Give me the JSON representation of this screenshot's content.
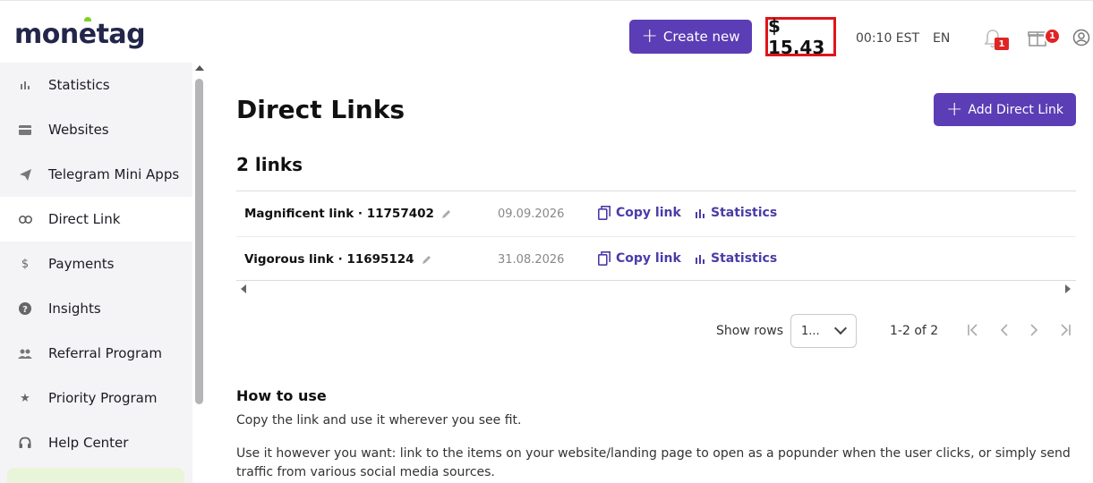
{
  "header": {
    "logo": "monetag",
    "create_label": "Create new",
    "balance": "$ 15.43",
    "time": "00:10 EST",
    "lang": "EN",
    "notif_count": "1",
    "gift_count": "1"
  },
  "sidebar": {
    "items": [
      {
        "label": "Statistics",
        "icon": "bar-chart-icon"
      },
      {
        "label": "Websites",
        "icon": "card-icon"
      },
      {
        "label": "Telegram Mini Apps",
        "icon": "paper-plane-icon"
      },
      {
        "label": "Direct Link",
        "icon": "link-icon"
      },
      {
        "label": "Payments",
        "icon": "dollar-icon"
      },
      {
        "label": "Insights",
        "icon": "question-icon"
      },
      {
        "label": "Referral Program",
        "icon": "people-icon"
      },
      {
        "label": "Priority Program",
        "icon": "star-icon"
      },
      {
        "label": "Help Center",
        "icon": "headset-icon"
      }
    ],
    "active": "Direct Link"
  },
  "main": {
    "title": "Direct Links",
    "add_label": "Add Direct Link",
    "count_label": "2 links",
    "rows": [
      {
        "name": "Magnificent link · 11757402",
        "date": "09.09.2026",
        "copy": "Copy link",
        "stats": "Statistics"
      },
      {
        "name": "Vigorous link · 11695124",
        "date": "31.08.2026",
        "copy": "Copy link",
        "stats": "Statistics"
      }
    ],
    "pagination": {
      "show_rows_label": "Show rows",
      "rows_value": "1...",
      "range": "1-2 of 2"
    },
    "how_to_use": {
      "title": "How to use",
      "p1": "Copy the link and use it wherever you see fit.",
      "p2": "Use it however you want: link to the items on your website/landing page to open as a popunder when the user clicks, or simply send traffic from various social media sources."
    }
  },
  "colors": {
    "accent": "#5b3db5",
    "link": "#4a3ca8",
    "highlight": "#e0141a",
    "badge": "#e02424"
  }
}
